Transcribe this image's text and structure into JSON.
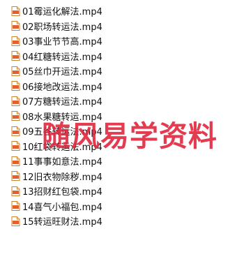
{
  "files": [
    {
      "name": "01霉运化解法.mp4",
      "icon": "video-file-icon"
    },
    {
      "name": "02职场转运法.mp4",
      "icon": "video-file-icon"
    },
    {
      "name": "03事业节节高.mp4",
      "icon": "video-file-icon"
    },
    {
      "name": "04红糖转运法.mp4",
      "icon": "video-file-icon"
    },
    {
      "name": "05丝巾开运法.mp4",
      "icon": "video-file-icon"
    },
    {
      "name": "06接地改运法.mp4",
      "icon": "video-file-icon"
    },
    {
      "name": "07方糖转运法.mp4",
      "icon": "video-file-icon"
    },
    {
      "name": "08水果糖转运.mp4",
      "icon": "video-file-icon"
    },
    {
      "name": "09五谷转运法.mp4",
      "icon": "video-file-icon"
    },
    {
      "name": "10红袋转运法.mp4",
      "icon": "video-file-icon"
    },
    {
      "name": "11事事如意法.mp4",
      "icon": "video-file-icon"
    },
    {
      "name": "12旧衣物除秽.mp4",
      "icon": "video-file-icon"
    },
    {
      "name": "13招财红包袋.mp4",
      "icon": "video-file-icon"
    },
    {
      "name": "14喜气小福包.mp4",
      "icon": "video-file-icon"
    },
    {
      "name": "15转运旺财法.mp4",
      "icon": "video-file-icon"
    }
  ],
  "watermark": "随风易学资料",
  "colors": {
    "icon_accent": "#e0622e",
    "watermark": "#e0263d"
  }
}
